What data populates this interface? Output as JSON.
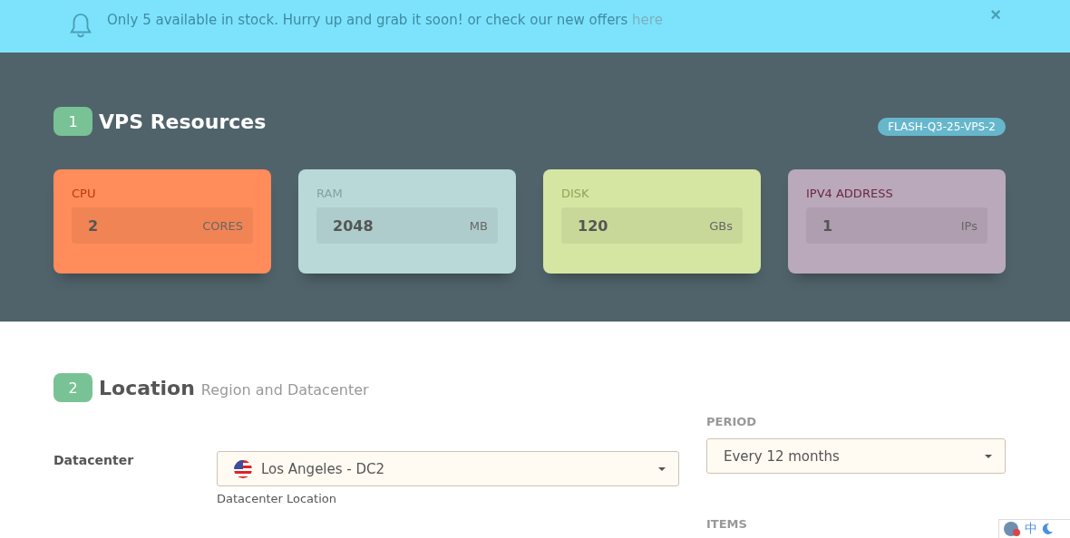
{
  "notice": {
    "text": "Only 5 available in stock. Hurry up and grab it soon! or check our new offers",
    "link": "here",
    "close": "×"
  },
  "resources": {
    "step": "1",
    "title": "VPS Resources",
    "promo_code": "FLASH-Q3-25-VPS-2",
    "cards": [
      {
        "label": "CPU",
        "value": "2",
        "unit": "CORES",
        "color": "#ff8c5a"
      },
      {
        "label": "RAM",
        "value": "2048",
        "unit": "MB",
        "color": "#b8d9d8"
      },
      {
        "label": "DISK",
        "value": "120",
        "unit": "GBs",
        "color": "#d5e6a3"
      },
      {
        "label": "IPV4 ADDRESS",
        "value": "1",
        "unit": "IPs",
        "color": "#baa8bb"
      }
    ]
  },
  "location": {
    "step": "2",
    "title": "Location",
    "subtitle": "Region and Datacenter",
    "datacenter_label": "Datacenter",
    "datacenter_value": "Los Angeles - DC2",
    "datacenter_help": "Datacenter Location",
    "period_label": "PERIOD",
    "period_value": "Every 12 months",
    "items_label": "ITEMS"
  },
  "ime_toolbar": {
    "mode": "中"
  }
}
